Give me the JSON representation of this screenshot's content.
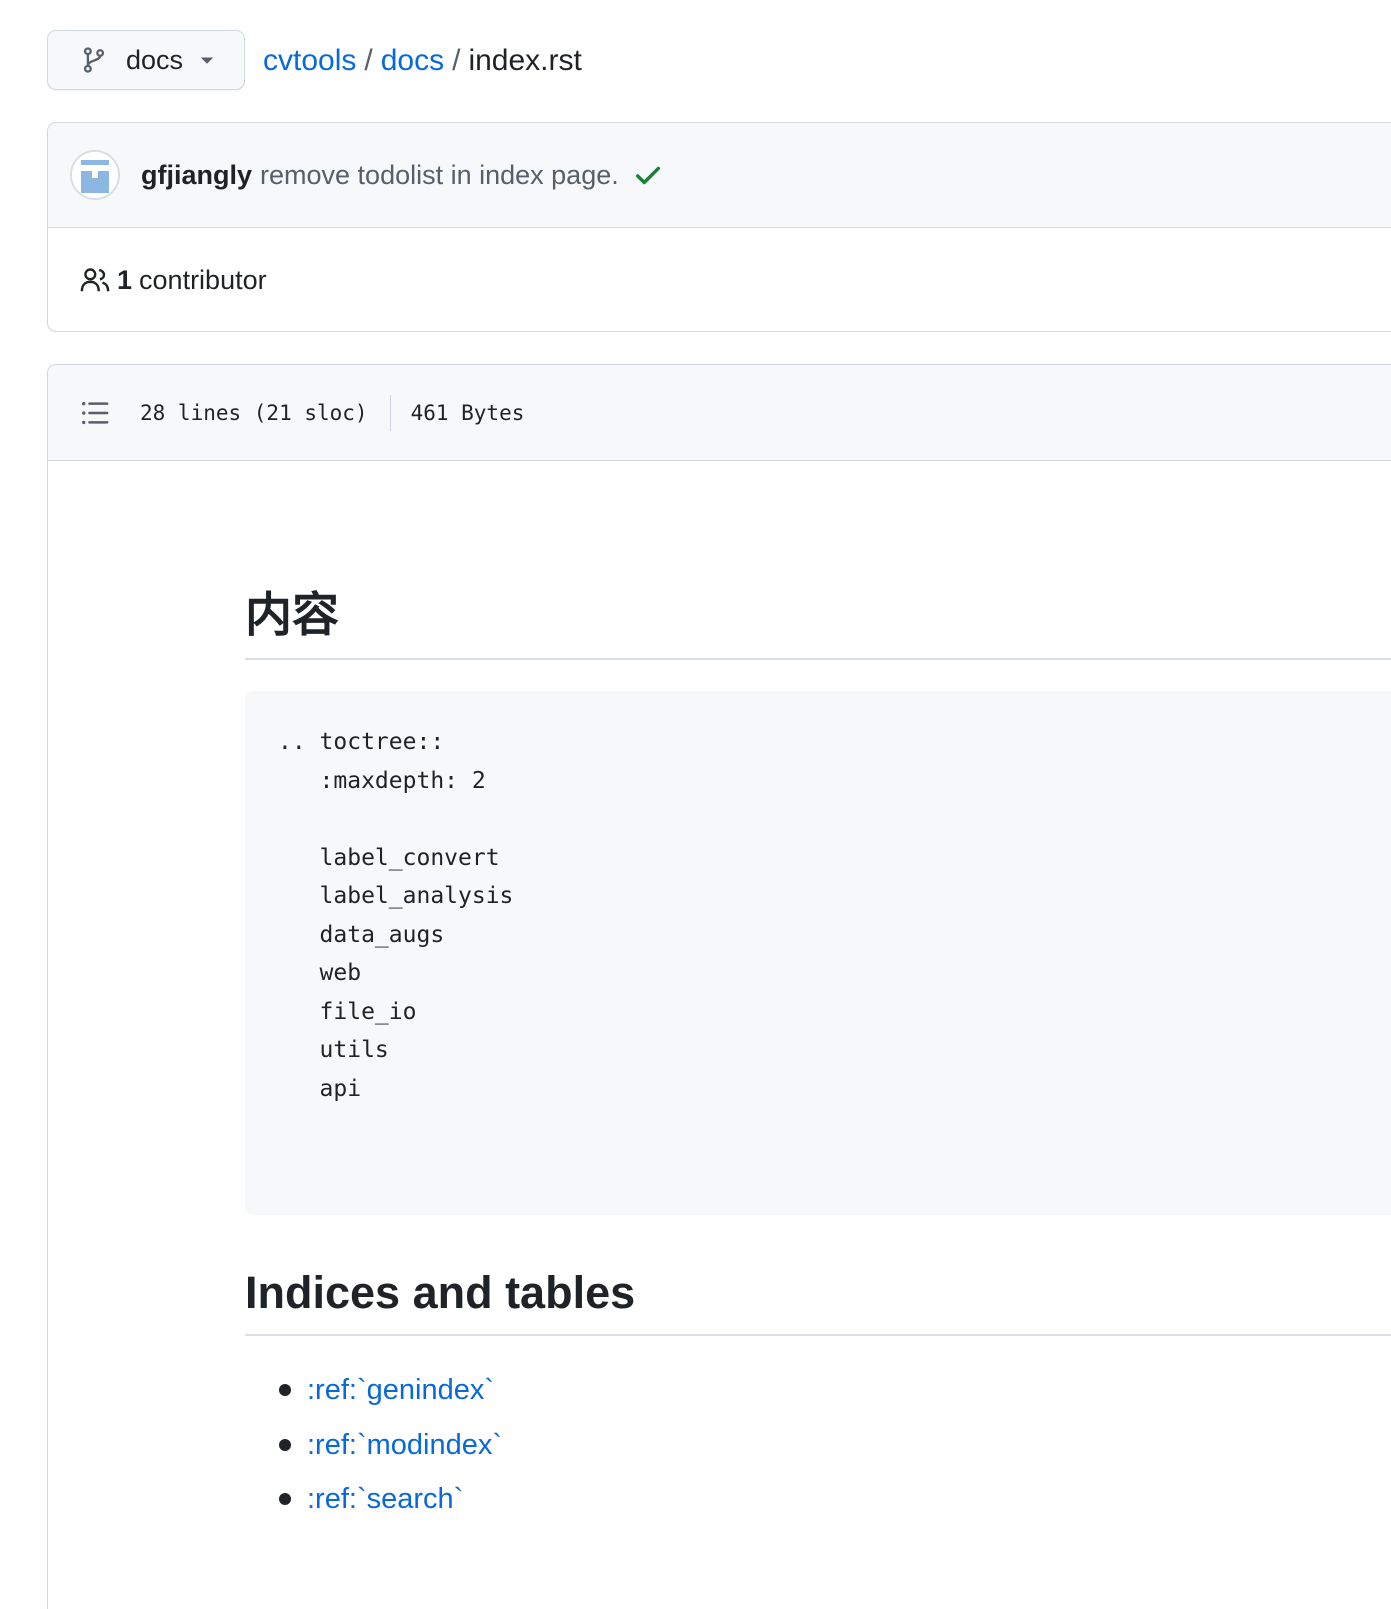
{
  "branch": {
    "name": "docs",
    "icon": "git-branch-icon",
    "caret_icon": "triangle-down-icon"
  },
  "breadcrumb": {
    "repo": "cvtools",
    "sep": "/",
    "folder": "docs",
    "file": "index.rst"
  },
  "commit": {
    "author": "gfjiangly",
    "message": "remove todolist in index page.",
    "status_icon": "check-icon",
    "status_color": "#1a7f37"
  },
  "contributors": {
    "icon": "people-icon",
    "count": "1",
    "label": "contributor"
  },
  "file_info": {
    "outline_icon": "list-unordered-icon",
    "lines": "28 lines (21 sloc)",
    "size": "461 Bytes"
  },
  "doc": {
    "heading1": "内容",
    "code": ".. toctree::\n   :maxdepth: 2\n\n   label_convert\n   label_analysis\n   data_augs\n   web\n   file_io\n   utils\n   api",
    "heading2": "Indices and tables",
    "links": [
      {
        "label": ":ref:`genindex`"
      },
      {
        "label": ":ref:`modindex`"
      },
      {
        "label": ":ref:`search`"
      }
    ]
  },
  "colors": {
    "link": "#0969da",
    "text": "#1f2328",
    "muted": "#57606a",
    "border": "#d0d7de",
    "subtle_bg": "#f6f8fa"
  }
}
